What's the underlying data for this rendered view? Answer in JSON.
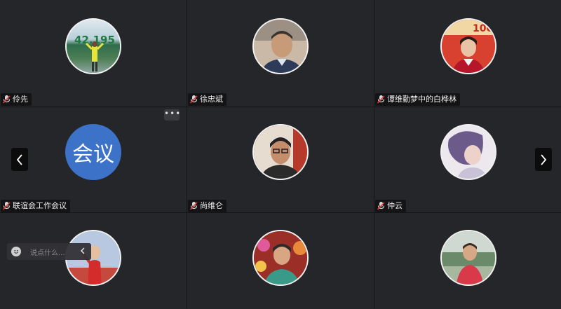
{
  "participants": [
    {
      "name": "伶先",
      "avatar": "photo-running-person"
    },
    {
      "name": "徐忠斌",
      "avatar": "photo-man-portrait"
    },
    {
      "name": "谭维勤梦中的白桦林",
      "avatar": "photo-woman-red-banner"
    },
    {
      "name": "联谊会工作会议",
      "avatar_text": "会议"
    },
    {
      "name": "尚维仑",
      "avatar": "photo-man-glasses"
    },
    {
      "name": "仲云",
      "avatar": "photo-woman-side"
    },
    {
      "name": "",
      "avatar": "photo-woman-red-dress"
    },
    {
      "name": "",
      "avatar": "photo-person-flowers"
    },
    {
      "name": "",
      "avatar": "photo-woman-lake"
    }
  ],
  "more_button": "•••",
  "chat": {
    "placeholder": "说点什么..."
  },
  "colors": {
    "background": "#252629",
    "meeting_avatar": "#3d72c9",
    "avatar_border": "#f2f2f2"
  },
  "icons": {
    "mic": "microphone-icon",
    "left": "chevron-left-icon",
    "right": "chevron-right-icon",
    "emoji": "emoji-icon",
    "collapse": "chevron-left-icon"
  }
}
